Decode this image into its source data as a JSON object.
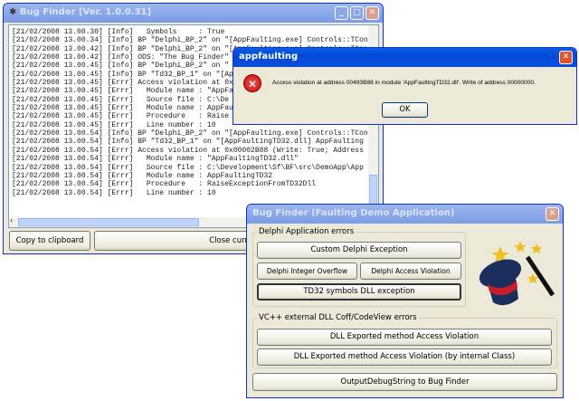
{
  "main_window": {
    "title": "Bug Finder [Ver. 1.0.0.31]",
    "log_lines": [
      "[21/02/2008 13.00.30] [Info]   Symbols     : True",
      "[21/02/2008 13.00.34] [Info] BP \"Delphi_BP_2\" on \"[AppFaulting.exe] Controls::TCon",
      "[21/02/2008 13.00.42] [Info] BP \"Delphi_BP_2\" on \"[AppFaulting.exe] Controls::TCon",
      "[21/02/2008 13.00.42] [Info] ODS: \"The Bug Finder\"",
      "[21/02/2008 13.00.45] [Info] BP \"Delphi_BP_2\" on \"",
      "[21/02/2008 13.00.45] [Info] BP \"Td32_BP_1\" on \"[Ap",
      "[21/02/2008 13.00.45] [Errr] Access violation at 0x",
      "[21/02/2008 13.00.45] [Errr]   Module name : \"AppFa",
      "[21/02/2008 13.00.45] [Errr]   Source file : C:\\De",
      "[21/02/2008 13.00.45] [Errr]   Module name : AppFau",
      "[21/02/2008 13.00.45] [Errr]   Procedure   : Raise",
      "[21/02/2008 13.00.45] [Errr]   Line number : 10",
      "[21/02/2008 13.00.54] [Info] BP \"Delphi_BP_2\" on \"[AppFaulting.exe] Controls::TCon",
      "[21/02/2008 13.00.54] [Info] BP \"Td32_BP_1\" on \"[AppFaultingTD32.dll] AppFaulting",
      "[21/02/2008 13.00.54] [Errr] Access violation at 0x00002B88 (Write: True; Address",
      "[21/02/2008 13.00.54] [Errr]   Module name : \"AppFaultingTD32.dll\"",
      "[21/02/2008 13.00.54] [Errr]   Source file : C:\\Development\\Sf\\BF\\src\\DemoApp\\App",
      "[21/02/2008 13.00.54] [Errr]   Module name : AppFaultingTD32",
      "[21/02/2008 13.00.54] [Errr]   Procedure   : RaiseExceptionFromTD32Dll",
      "[21/02/2008 13.00.54] [Errr]   Line number : 10"
    ],
    "copy_label": "Copy to clipboard",
    "close_label": "Close current l"
  },
  "error_dialog": {
    "title": "appfaulting",
    "message": "Access violation at address 00493B88 in module 'AppFaultingTD32.dll'. Write of address 00000000.",
    "ok_label": "OK",
    "icon": "error-icon"
  },
  "demo_window": {
    "title": "Bug Finder (Faulting Demo Application)",
    "group1_label": "Delphi Application errors",
    "custom_exception": "Custom Delphi Exception",
    "integer_overflow": "Delphi Integer Overflow",
    "access_violation": "Delphi Access Violation",
    "td32_exception": "TD32 symbols DLL exception",
    "group2_label": "VC++ external DLL Coff/CodeView errors",
    "dll_av": "DLL Exported method Access Violation",
    "dll_av_class": "DLL Exported method Access Violation (by internal Class)",
    "ods": "OutputDebugString to Bug Finder",
    "image": "magic-hat"
  }
}
